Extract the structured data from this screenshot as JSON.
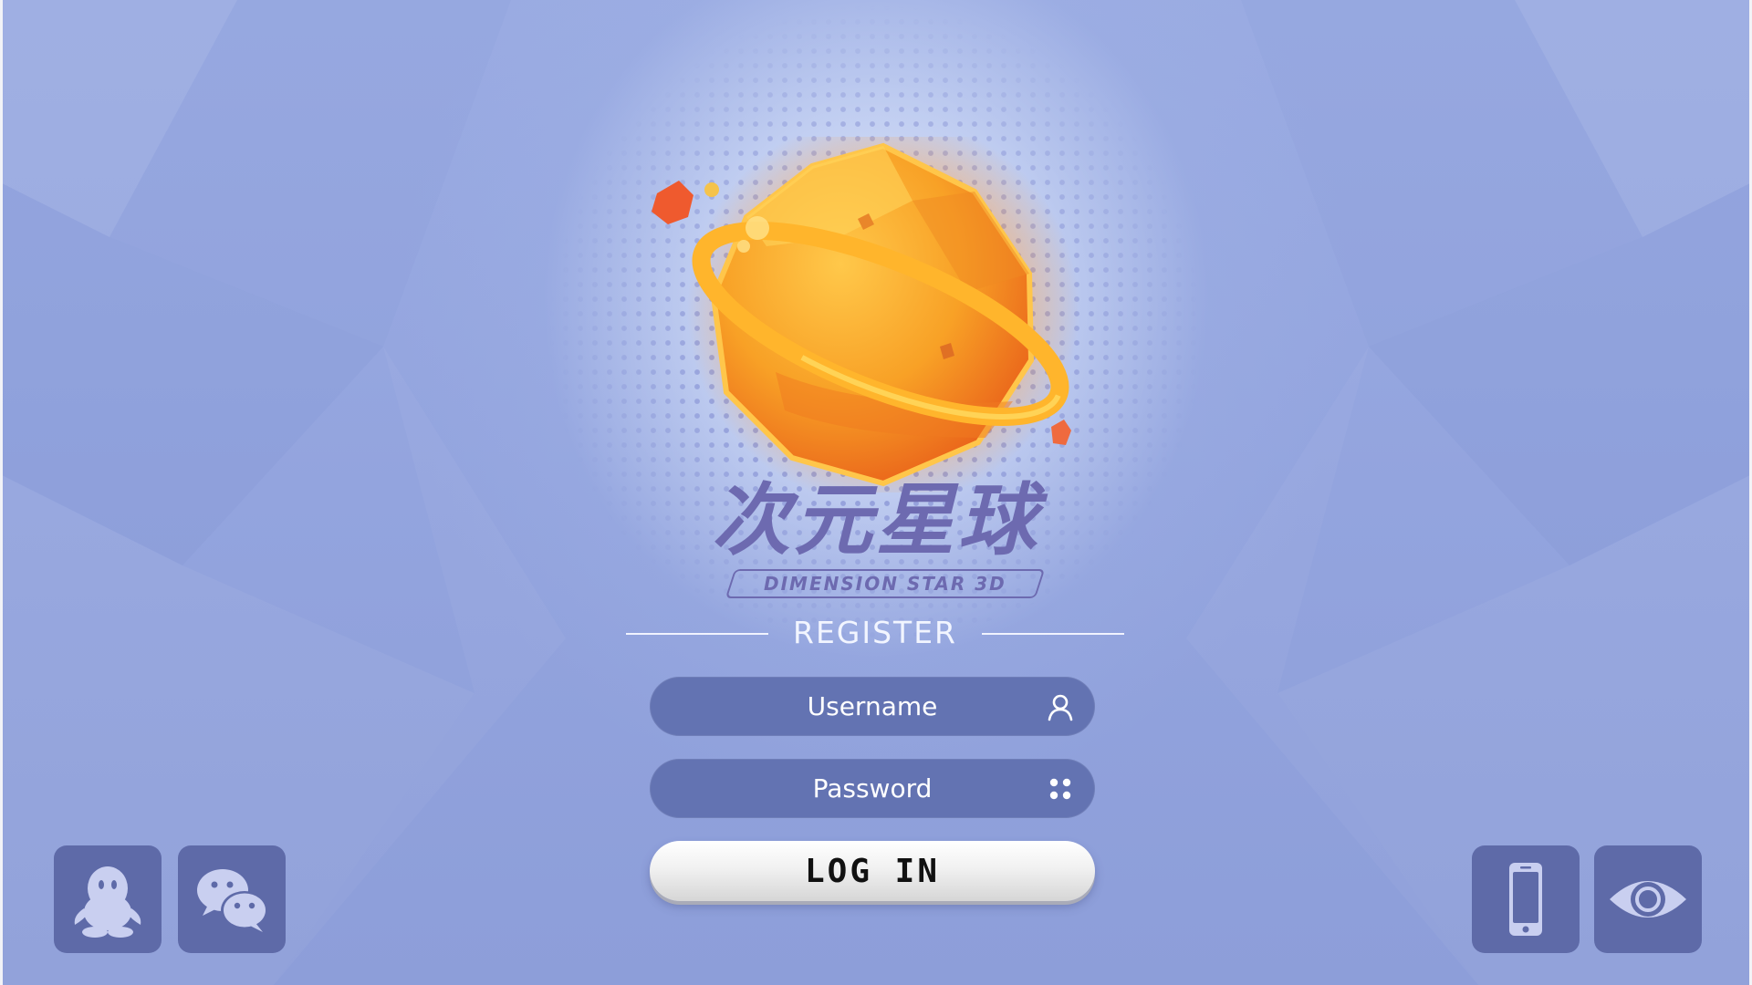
{
  "logo": {
    "title": "次元星球",
    "subtitle": "DIMENSION STAR 3D"
  },
  "form": {
    "heading": "REGISTER",
    "username_placeholder": "Username",
    "password_placeholder": "Password",
    "login_label": "LOG IN"
  },
  "icons": {
    "username_field": "user-icon",
    "password_field": "keypad-icon",
    "qq_login": "qq-penguin-icon",
    "wechat_login": "wechat-icon",
    "phone_login": "mobile-phone-icon",
    "guest_login": "eye-icon"
  },
  "colors": {
    "background": "#8d9ed8",
    "field": "#6373b2",
    "tile": "#5e6aa8",
    "logo_text": "#6d6ab0",
    "planet": "#f5a020"
  }
}
